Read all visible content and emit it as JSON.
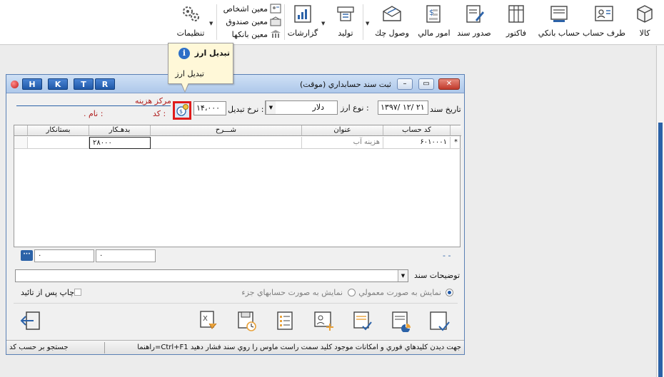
{
  "ribbon": {
    "buttons": [
      {
        "id": "kala",
        "label": "کالا",
        "icon": "box-icon"
      },
      {
        "id": "taraf",
        "label": "طرف حساب",
        "icon": "contact-card-icon"
      },
      {
        "id": "bank",
        "label": "حساب بانکي",
        "icon": "bank-account-icon"
      },
      {
        "id": "factor",
        "label": "فاکتور",
        "icon": "invoice-icon"
      },
      {
        "id": "sanad",
        "label": "صدور سند",
        "icon": "document-pen-icon"
      },
      {
        "id": "mali",
        "label": "امور مالي",
        "icon": "finance-icon"
      },
      {
        "id": "check",
        "label": "وصول چك",
        "icon": "check-envelope-icon"
      },
      {
        "id": "tolid",
        "label": "توليد",
        "icon": "production-icon"
      },
      {
        "id": "report",
        "label": "گزارشات",
        "icon": "report-chart-icon"
      },
      {
        "id": "settings",
        "label": "تنظيمات",
        "icon": "gears-icon"
      }
    ],
    "small": [
      {
        "label": "معين اشخاص",
        "icon": "persons-icon"
      },
      {
        "label": "معين صندوق",
        "icon": "cash-box-icon"
      },
      {
        "label": "معين بانكها",
        "icon": "bank-icon"
      }
    ]
  },
  "tooltip": {
    "title": "تبديل ارز",
    "body": "تبديل ارز"
  },
  "dialog": {
    "title": "ثبت سند حسابداري (موقت)",
    "letters": [
      "H",
      "K",
      "T",
      "R"
    ],
    "date_label": "تاريخ سند",
    "date_value": "۱۳۹۷/ ۱۲/ ۲۱",
    "currency_label": "نوع ارز :",
    "currency_value": "دلار",
    "rate_label": "نرخ تبديل :",
    "rate_value": "۱۴،۰۰۰",
    "cost_center_label": "مركز هزينه",
    "code_label": "كد :",
    "name_label": ". نام :",
    "grid": {
      "headers": [
        "كد حساب",
        "عنوان",
        "شـــرح",
        "بدهـكار",
        "بستانكار"
      ],
      "row": {
        "marker": "*",
        "code": "۶۰۱۰۰۰۱",
        "title": "هزينه آب",
        "desc": "",
        "debit": "۲۸۰۰۰",
        "credit": ""
      }
    },
    "totals": {
      "debit": "۰",
      "credit": "۰",
      "dash": "- -"
    },
    "desc_label": "توضيحات سند",
    "radio_normal": "نمايش به صورت معمولي",
    "radio_detail": "نمايش به صورت حسابهاي جزء",
    "print_label": "چاپ پس از تائيد",
    "status_left": "جستجو بر حسب كد",
    "status_right": "راهنما=Ctrl+F1 جهت ديدن كليدهاي فوري و امكانات موجود كليد سمت راست ماوس را روي سند فشار دهيد"
  },
  "colors": {
    "accent": "#1f58a8",
    "highlight": "#e01b1b",
    "tooltip_bg": "#fff8d8"
  }
}
